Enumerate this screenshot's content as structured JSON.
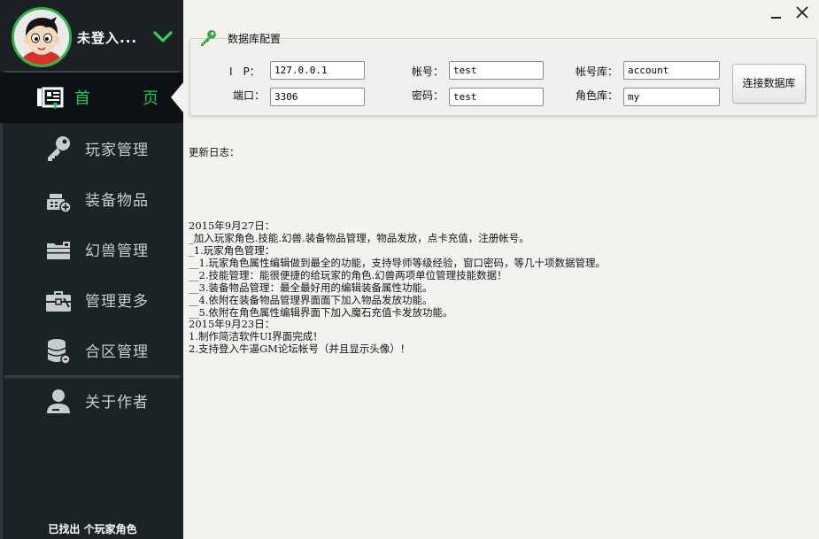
{
  "sidebar": {
    "user": {
      "name": "未登入...",
      "avatar_icon": "boy-avatar-icon",
      "chevron_icon": "chevron-down-icon",
      "accent": "#2fb44a"
    },
    "nav": [
      {
        "id": "home",
        "label_a": "首",
        "label_b": "页",
        "icon": "home-dashboard-icon",
        "active": true
      },
      {
        "id": "players",
        "label": "玩家管理",
        "icon": "key-icon"
      },
      {
        "id": "equipment",
        "label": "装备物品",
        "icon": "cash-register-icon"
      },
      {
        "id": "pets",
        "label": "幻兽管理",
        "icon": "folder-icon"
      },
      {
        "id": "more",
        "label": "管理更多",
        "icon": "toolbox-icon"
      },
      {
        "id": "zones",
        "label": "合区管理",
        "icon": "database-icon"
      },
      {
        "id": "about",
        "label": "关于作者",
        "icon": "person-icon"
      }
    ],
    "footer": "已找出 个玩家角色",
    "active_color": "#1dc85a"
  },
  "window": {
    "minimize_icon": "minimize-icon",
    "close_icon": "close-icon"
  },
  "config": {
    "title": "数据库配置",
    "title_icon": "green-key-icon",
    "ip_label": "I　P：",
    "ip_value": "127.0.0.1",
    "port_label": "端口：",
    "port_value": "3306",
    "account_label": "帐号：",
    "account_value": "test",
    "password_label": "密码：",
    "password_value": "test",
    "account_db_label": "帐号库：",
    "account_db_value": "account",
    "role_db_label": "角色库：",
    "role_db_value": "my",
    "connect_button": "连接数据库"
  },
  "log": {
    "header": "更新日志：",
    "lines": [
      "2015年9月27日：",
      "_加入玩家角色.技能.幻兽.装备物品管理，物品发放，点卡充值，注册帐号。",
      "_1.玩家角色管理：",
      "__1.玩家角色属性编辑做到最全的功能，支持导师等级经验，窗口密码，等几十项数据管理。",
      "__2.技能管理：能很便捷的给玩家的角色.幻兽两项单位管理技能数据！",
      "__3.装备物品管理：最全最好用的编辑装备属性功能。",
      "__4.依附在装备物品管理界面面下加入物品发放功能。",
      "__5.依附在角色属性编辑界面下加入魔石充值卡发放功能。",
      "2015年9月23日：",
      "1.制作简洁软件UI界面完成！",
      "2.支持登入牛逼GM论坛帐号（并且显示头像）！"
    ]
  }
}
